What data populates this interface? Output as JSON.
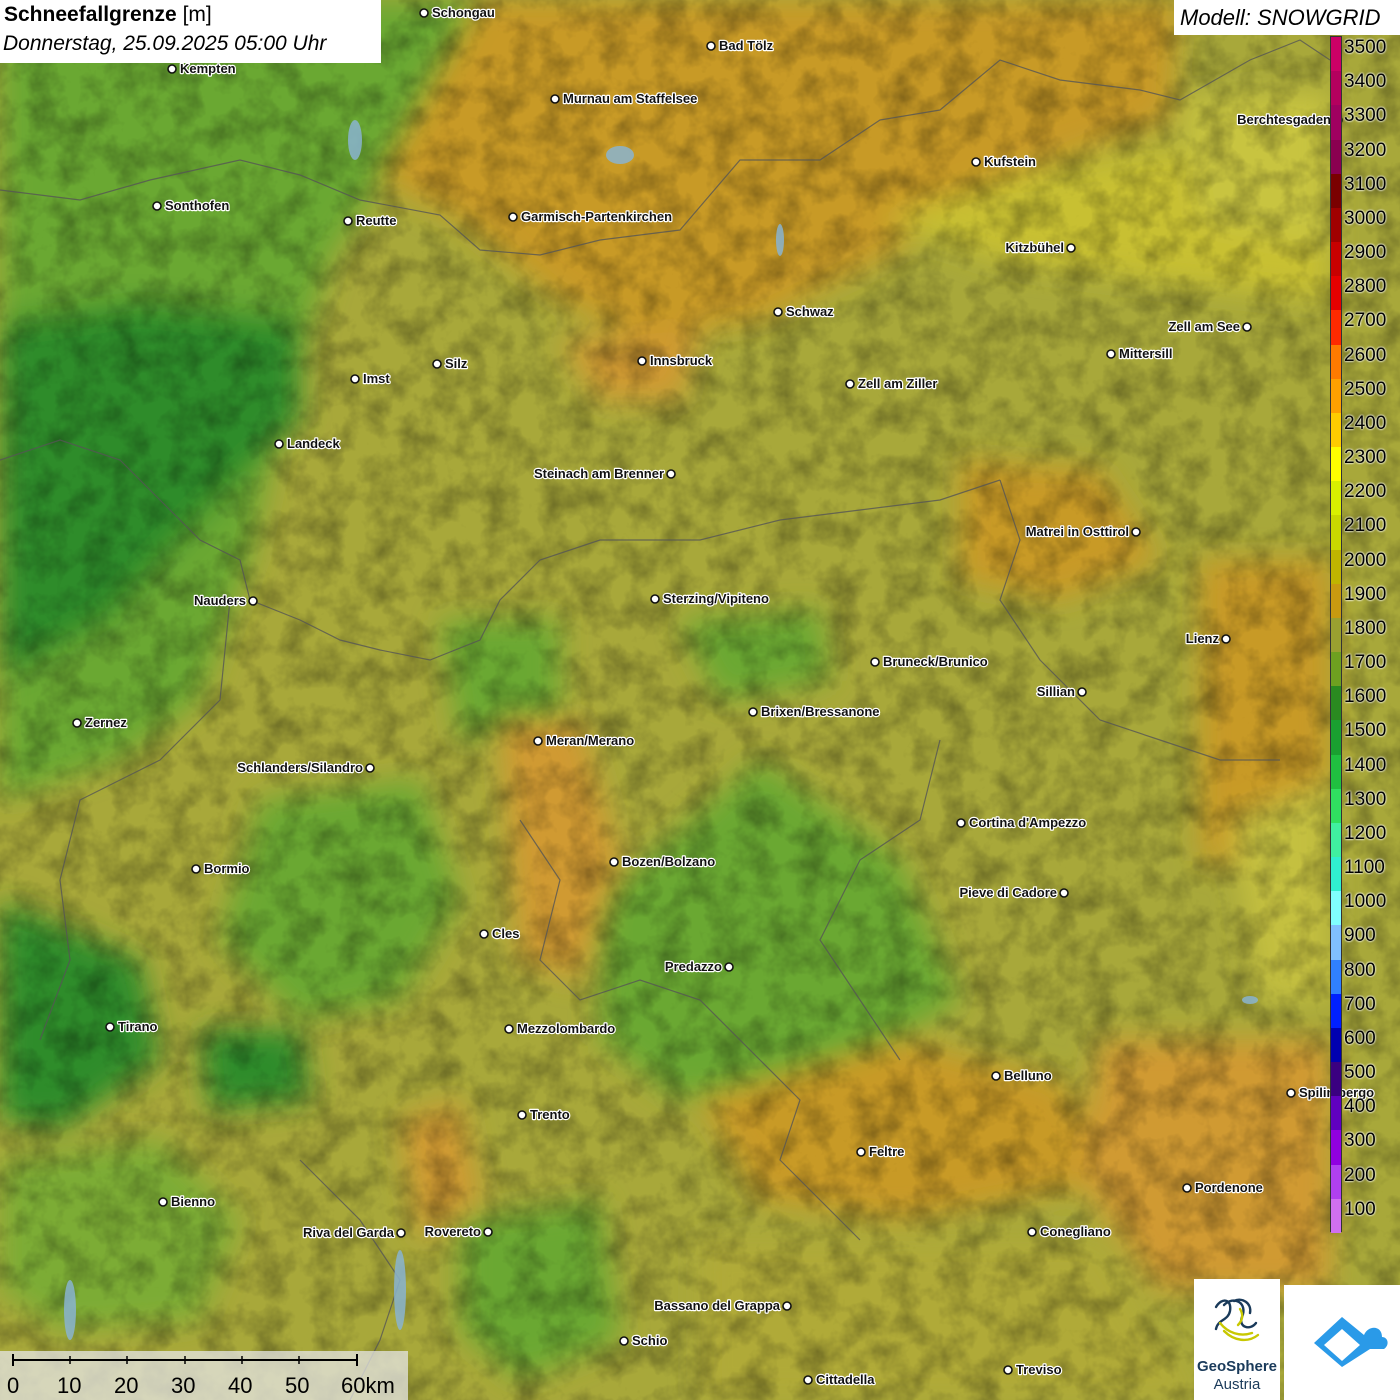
{
  "title": {
    "variable": "Schneefallgrenze",
    "unit": "[m]",
    "datetime": "Donnerstag, 25.09.2025 05:00 Uhr"
  },
  "model": "Modell: SNOWGRID",
  "legend": {
    "levels": [
      {
        "label": "3500",
        "color": "#cc0066"
      },
      {
        "label": "3400",
        "color": "#b4005e"
      },
      {
        "label": "3300",
        "color": "#a00060"
      },
      {
        "label": "3200",
        "color": "#8a0050"
      },
      {
        "label": "3100",
        "color": "#7a0000"
      },
      {
        "label": "3000",
        "color": "#a00000"
      },
      {
        "label": "2900",
        "color": "#c80000"
      },
      {
        "label": "2800",
        "color": "#e60000"
      },
      {
        "label": "2700",
        "color": "#ff2a00"
      },
      {
        "label": "2600",
        "color": "#ff7a00"
      },
      {
        "label": "2500",
        "color": "#ffa000"
      },
      {
        "label": "2400",
        "color": "#ffcc00"
      },
      {
        "label": "2300",
        "color": "#ffff00"
      },
      {
        "label": "2200",
        "color": "#d8f000"
      },
      {
        "label": "2100",
        "color": "#c8d800"
      },
      {
        "label": "2000",
        "color": "#c0b400"
      },
      {
        "label": "1900",
        "color": "#c89a10"
      },
      {
        "label": "1800",
        "color": "#9aa030"
      },
      {
        "label": "1700",
        "color": "#6ea020"
      },
      {
        "label": "1600",
        "color": "#2a8a20"
      },
      {
        "label": "1500",
        "color": "#1aa030"
      },
      {
        "label": "1400",
        "color": "#20c040"
      },
      {
        "label": "1300",
        "color": "#30e060"
      },
      {
        "label": "1200",
        "color": "#40f0a0"
      },
      {
        "label": "1100",
        "color": "#30f0d0"
      },
      {
        "label": "1000",
        "color": "#80ffff"
      },
      {
        "label": "900",
        "color": "#80c0ff"
      },
      {
        "label": "800",
        "color": "#3080ff"
      },
      {
        "label": "700",
        "color": "#0020ff"
      },
      {
        "label": "600",
        "color": "#0000b0"
      },
      {
        "label": "500",
        "color": "#3a0080"
      },
      {
        "label": "400",
        "color": "#6000c0"
      },
      {
        "label": "300",
        "color": "#9000e0"
      },
      {
        "label": "200",
        "color": "#b040f0"
      },
      {
        "label": "100",
        "color": "#d070f0"
      }
    ]
  },
  "scalebar": {
    "labels": [
      "0",
      "10",
      "20",
      "30",
      "40",
      "50",
      "60km"
    ]
  },
  "cities": [
    {
      "name": "Schongau",
      "anchor": "right"
    },
    {
      "name": "Bad Tölz",
      "anchor": "right"
    },
    {
      "name": "Kempten",
      "anchor": "right"
    },
    {
      "name": "Murnau am Staffelsee",
      "anchor": "right"
    },
    {
      "name": "Berchtesgaden",
      "anchor": "left"
    },
    {
      "name": "Kufstein",
      "anchor": "right"
    },
    {
      "name": "Sonthofen",
      "anchor": "right"
    },
    {
      "name": "Reutte",
      "anchor": "right"
    },
    {
      "name": "Garmisch-Partenkirchen",
      "anchor": "right"
    },
    {
      "name": "Kitzbühel",
      "anchor": "left"
    },
    {
      "name": "Schwaz",
      "anchor": "right"
    },
    {
      "name": "Zell am See",
      "anchor": "left"
    },
    {
      "name": "Innsbruck",
      "anchor": "right"
    },
    {
      "name": "Mittersill",
      "anchor": "right"
    },
    {
      "name": "Imst",
      "anchor": "right"
    },
    {
      "name": "Silz",
      "anchor": "right"
    },
    {
      "name": "Zell am Ziller",
      "anchor": "right"
    },
    {
      "name": "Landeck",
      "anchor": "right"
    },
    {
      "name": "Steinach am Brenner",
      "anchor": "left"
    },
    {
      "name": "Matrei in Osttirol",
      "anchor": "left"
    },
    {
      "name": "Nauders",
      "anchor": "left"
    },
    {
      "name": "Sterzing/Vipiteno",
      "anchor": "right"
    },
    {
      "name": "Lienz",
      "anchor": "left"
    },
    {
      "name": "Bruneck/Brunico",
      "anchor": "right"
    },
    {
      "name": "Sillian",
      "anchor": "left"
    },
    {
      "name": "Brixen/Bressanone",
      "anchor": "right"
    },
    {
      "name": "Zernez",
      "anchor": "right"
    },
    {
      "name": "Meran/Merano",
      "anchor": "right"
    },
    {
      "name": "Schlanders/Silandro",
      "anchor": "left"
    },
    {
      "name": "Cortina d'Ampezzo",
      "anchor": "right"
    },
    {
      "name": "Bozen/Bolzano",
      "anchor": "right"
    },
    {
      "name": "Bormio",
      "anchor": "right"
    },
    {
      "name": "Pieve di Cadore",
      "anchor": "left"
    },
    {
      "name": "Cles",
      "anchor": "right"
    },
    {
      "name": "Predazzo",
      "anchor": "left"
    },
    {
      "name": "Tirano",
      "anchor": "right"
    },
    {
      "name": "Mezzolombardo",
      "anchor": "right"
    },
    {
      "name": "Belluno",
      "anchor": "right"
    },
    {
      "name": "Spilimbergo",
      "anchor": "right"
    },
    {
      "name": "Trento",
      "anchor": "right"
    },
    {
      "name": "Feltre",
      "anchor": "right"
    },
    {
      "name": "Pordenone",
      "anchor": "right"
    },
    {
      "name": "Bienno",
      "anchor": "right"
    },
    {
      "name": "Riva del Garda",
      "anchor": "left"
    },
    {
      "name": "Rovereto",
      "anchor": "left"
    },
    {
      "name": "Conegliano",
      "anchor": "right"
    },
    {
      "name": "Bassano del Grappa",
      "anchor": "left"
    },
    {
      "name": "Schio",
      "anchor": "right"
    },
    {
      "name": "Cittadella",
      "anchor": "right"
    },
    {
      "name": "Treviso",
      "anchor": "right"
    }
  ],
  "logos": {
    "geosphere_name": "GeoSphere",
    "geosphere_sub": "Austria"
  }
}
